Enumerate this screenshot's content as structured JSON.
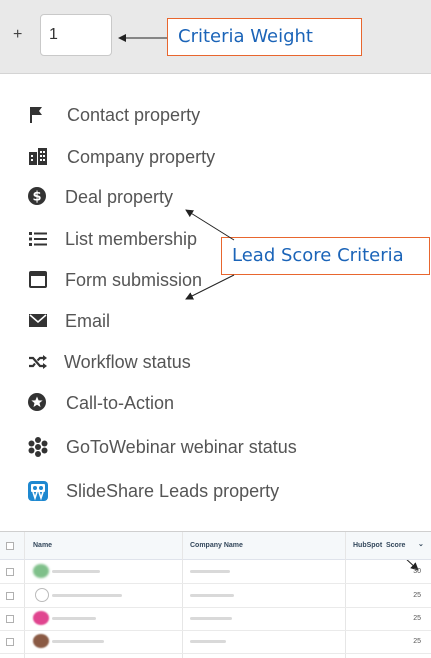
{
  "weight": {
    "plus": "+",
    "value": "1"
  },
  "callouts": {
    "weight": "Criteria Weight",
    "lead": "Lead Score Criteria"
  },
  "criteria": [
    {
      "label": "Contact property",
      "icon": "flag-icon"
    },
    {
      "label": "Company property",
      "icon": "building-icon"
    },
    {
      "label": "Deal property",
      "icon": "dollar-circle-icon"
    },
    {
      "label": "List membership",
      "icon": "list-icon"
    },
    {
      "label": "Form submission",
      "icon": "form-icon"
    },
    {
      "label": "Email",
      "icon": "envelope-icon"
    },
    {
      "label": "Workflow status",
      "icon": "shuffle-icon"
    },
    {
      "label": "Call-to-Action",
      "icon": "star-circle-icon"
    },
    {
      "label": "GoToWebinar webinar status",
      "icon": "gotowebinar-icon"
    },
    {
      "label": "SlideShare Leads property",
      "icon": "slideshare-icon"
    }
  ],
  "table": {
    "headers": {
      "name": "Name",
      "company": "Company Name",
      "score_prefix": "HubSpot",
      "score": "Score",
      "sort": "⌄"
    },
    "rows": [
      {
        "score": "30",
        "avatar_color": "#7fc08a"
      },
      {
        "score": "25",
        "avatar_color": "#ffffff"
      },
      {
        "score": "25",
        "avatar_color": "#e0458f"
      },
      {
        "score": "25",
        "avatar_color": "#8a5a44"
      }
    ]
  },
  "colors": {
    "callout_border": "#e8662e",
    "callout_text": "#1b64b8"
  }
}
